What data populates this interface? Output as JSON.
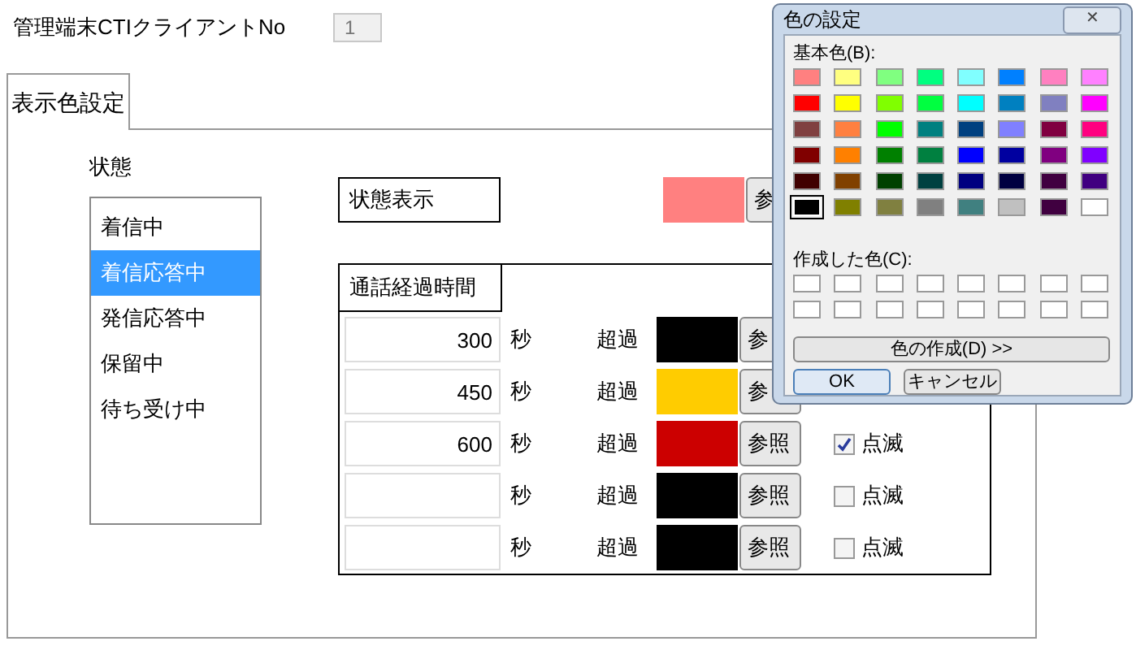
{
  "client_no": {
    "label": "管理端末CTIクライアントNo",
    "value": "1"
  },
  "tabs": [
    {
      "label": "表示色設定",
      "selected": true
    }
  ],
  "state_list": {
    "label": "状態",
    "items": [
      {
        "label": "着信中",
        "selected": false
      },
      {
        "label": "着信応答中",
        "selected": true
      },
      {
        "label": "発信応答中",
        "selected": false
      },
      {
        "label": "保留中",
        "selected": false
      },
      {
        "label": "待ち受け中",
        "selected": false
      }
    ]
  },
  "state_display": {
    "label": "状態表示",
    "color": "#ff8080",
    "button": "参"
  },
  "elapsed_time": {
    "label": "通話経過時間",
    "rows": [
      {
        "seconds": "300",
        "unit": "秒",
        "over": "超過",
        "color": "#000000",
        "button": "参"
      },
      {
        "seconds": "450",
        "unit": "秒",
        "over": "超過",
        "color": "#ffcc00",
        "button": "参"
      },
      {
        "seconds": "600",
        "unit": "秒",
        "over": "超過",
        "color": "#cc0000",
        "button": "参照",
        "blink": {
          "label": "点滅",
          "checked": true
        }
      },
      {
        "unit": "秒",
        "over": "超過",
        "color": "#000000",
        "button": "参照",
        "blink": {
          "label": "点滅",
          "checked": false
        }
      },
      {
        "unit": "秒",
        "over": "超過",
        "color": "#000000",
        "button": "参照",
        "blink": {
          "label": "点滅",
          "checked": false
        }
      }
    ]
  },
  "color_dialog": {
    "title": "色の設定",
    "close": "✕",
    "basic_label": "基本色(B):",
    "basic_colors": [
      {
        "color": "#ff8080",
        "selected": false
      },
      {
        "color": "#ffff80",
        "selected": false
      },
      {
        "color": "#80ff80",
        "selected": false
      },
      {
        "color": "#00ff80",
        "selected": false
      },
      {
        "color": "#80ffff",
        "selected": false
      },
      {
        "color": "#0080ff",
        "selected": false
      },
      {
        "color": "#ff80c0",
        "selected": false
      },
      {
        "color": "#ff80ff",
        "selected": false
      },
      {
        "color": "#ff0000",
        "selected": false
      },
      {
        "color": "#ffff00",
        "selected": false
      },
      {
        "color": "#80ff00",
        "selected": false
      },
      {
        "color": "#00ff40",
        "selected": false
      },
      {
        "color": "#00ffff",
        "selected": false
      },
      {
        "color": "#0080c0",
        "selected": false
      },
      {
        "color": "#8080c0",
        "selected": false
      },
      {
        "color": "#ff00ff",
        "selected": false
      },
      {
        "color": "#804040",
        "selected": false
      },
      {
        "color": "#ff8040",
        "selected": false
      },
      {
        "color": "#00ff00",
        "selected": false
      },
      {
        "color": "#008080",
        "selected": false
      },
      {
        "color": "#004080",
        "selected": false
      },
      {
        "color": "#8080ff",
        "selected": false
      },
      {
        "color": "#800040",
        "selected": false
      },
      {
        "color": "#ff0080",
        "selected": false
      },
      {
        "color": "#800000",
        "selected": false
      },
      {
        "color": "#ff8000",
        "selected": false
      },
      {
        "color": "#008000",
        "selected": false
      },
      {
        "color": "#008040",
        "selected": false
      },
      {
        "color": "#0000ff",
        "selected": false
      },
      {
        "color": "#0000a0",
        "selected": false
      },
      {
        "color": "#800080",
        "selected": false
      },
      {
        "color": "#8000ff",
        "selected": false
      },
      {
        "color": "#400000",
        "selected": false
      },
      {
        "color": "#804000",
        "selected": false
      },
      {
        "color": "#004000",
        "selected": false
      },
      {
        "color": "#004040",
        "selected": false
      },
      {
        "color": "#000080",
        "selected": false
      },
      {
        "color": "#000040",
        "selected": false
      },
      {
        "color": "#400040",
        "selected": false
      },
      {
        "color": "#400080",
        "selected": false
      },
      {
        "color": "#000000",
        "selected": true
      },
      {
        "color": "#808000",
        "selected": false
      },
      {
        "color": "#808040",
        "selected": false
      },
      {
        "color": "#808080",
        "selected": false
      },
      {
        "color": "#408080",
        "selected": false
      },
      {
        "color": "#c0c0c0",
        "selected": false
      },
      {
        "color": "#400040",
        "selected": false
      },
      {
        "color": "#ffffff",
        "selected": false
      }
    ],
    "custom_label": "作成した色(C):",
    "define_button": "色の作成(D) >>",
    "ok_button": "OK",
    "cancel_button": "キャンセル"
  }
}
